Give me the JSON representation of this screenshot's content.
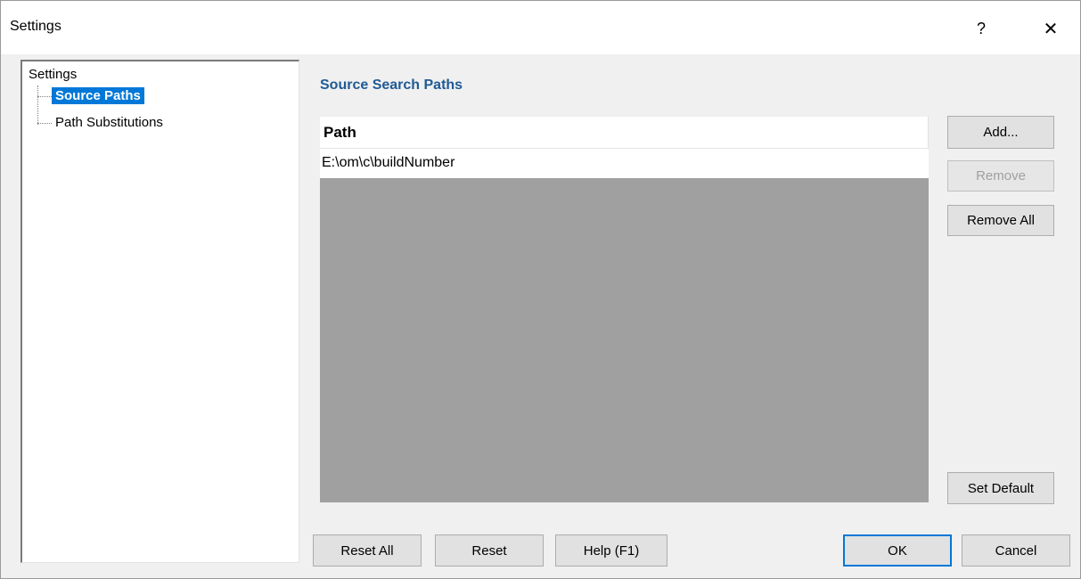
{
  "window": {
    "title": "Settings",
    "help_glyph": "?",
    "close_glyph": "✕"
  },
  "tree": {
    "root": "Settings",
    "items": [
      {
        "label": "Source Paths",
        "selected": true
      },
      {
        "label": "Path Substitutions",
        "selected": false
      }
    ]
  },
  "panel": {
    "section_title": "Source Search Paths",
    "column_header": "Path",
    "rows": [
      "E:\\om\\c\\buildNumber"
    ]
  },
  "side_buttons": {
    "add": "Add...",
    "remove": "Remove",
    "remove_all": "Remove All",
    "set_default": "Set Default"
  },
  "footer_buttons": {
    "reset_all": "Reset All",
    "reset": "Reset",
    "help": "Help (F1)",
    "ok": "OK",
    "cancel": "Cancel"
  },
  "colors": {
    "accent": "#0078d7",
    "section_title": "#1f5a94",
    "list_background": "#a0a0a0"
  }
}
